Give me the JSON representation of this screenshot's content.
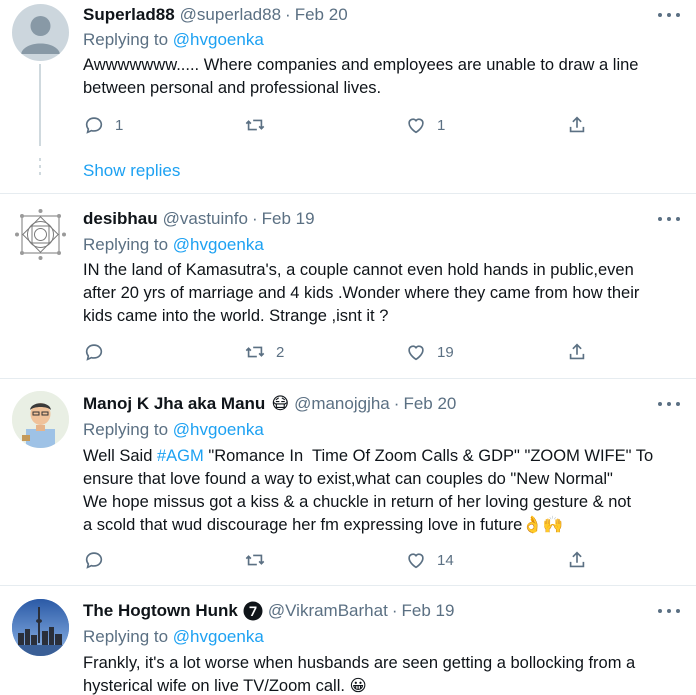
{
  "tweets": [
    {
      "name": "Superlad88",
      "handle": "@superlad88",
      "date": "Feb 20",
      "reply_label": "Replying to",
      "reply_mention": "@hvgoenka",
      "lines": [
        "Awwwwwww..... Where companies and employees are unable to draw a line",
        "between personal and professional lives."
      ],
      "reply_count": "1",
      "retweet_count": "",
      "like_count": "1",
      "show_replies": "Show replies"
    },
    {
      "name": "desibhau",
      "handle": "@vastuinfo",
      "date": "Feb 19",
      "reply_label": "Replying to",
      "reply_mention": "@hvgoenka",
      "lines": [
        "IN the land of Kamasutra's, a couple cannot even hold hands in public,even",
        "after 20 yrs of marriage and 4 kids .Wonder where they came from how their",
        "kids came into the world. Strange ,isnt it ?"
      ],
      "reply_count": "",
      "retweet_count": "2",
      "like_count": "19"
    },
    {
      "name": "Manoj K Jha aka Manu",
      "name_emoji": "😷",
      "handle": "@manojgjha",
      "date": "Feb 20",
      "reply_label": "Replying to",
      "reply_mention": "@hvgoenka",
      "line1_pre": "Well Said ",
      "line1_tag": "#AGM",
      "line1_post": " \"Romance In  Time Of Zoom Calls & GDP\" \"ZOOM WIFE\" To",
      "lines": [
        "ensure that love found a way to exist,what can couples do \"New Normal\"",
        "We hope missus got a kiss & a chuckle in return of her loving gesture & not",
        "a scold that wud discourage her fm expressing love in future👌🙌"
      ],
      "reply_count": "",
      "retweet_count": "",
      "like_count": "14"
    },
    {
      "name": "The Hogtown Hunk",
      "handle": "@VikramBarhat",
      "date": "Feb 19",
      "reply_label": "Replying to",
      "reply_mention": "@hvgoenka",
      "lines": [
        "Frankly, it's a lot worse when husbands are seen getting a bollocking from a",
        "hysterical wife on live TV/Zoom call.  😀"
      ]
    }
  ],
  "separators": [
    "·",
    "·",
    "·",
    "·"
  ],
  "colors": {
    "accent": "#1da1f2",
    "muted": "#5b7083",
    "text": "#0f1419",
    "border": "#e6ecf0"
  },
  "icons": [
    "reply-icon",
    "retweet-icon",
    "like-icon",
    "share-icon",
    "more-icon",
    "verified-7-badge-icon"
  ]
}
